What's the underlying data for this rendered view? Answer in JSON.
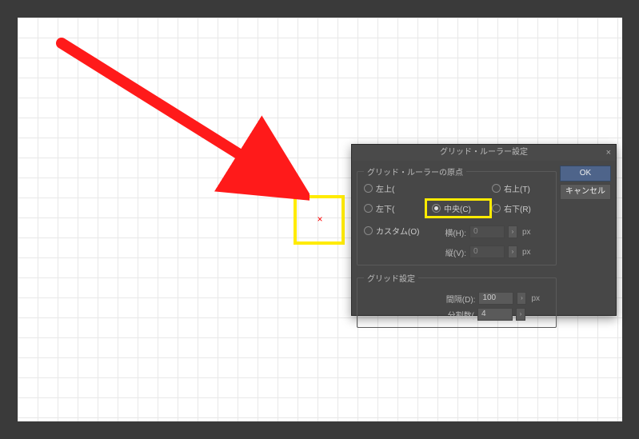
{
  "dialog": {
    "title": "グリッド・ルーラー設定",
    "origin": {
      "legend": "グリッド・ルーラーの原点",
      "top_left": "左上(",
      "center": "中央(C)",
      "top_right": "右上(T)",
      "bottom_left": "左下(",
      "bottom_right": "右下(R)",
      "custom": "カスタム(O)",
      "h_label": "横(H):",
      "h_value": "0",
      "v_label": "縦(V):",
      "v_value": "0",
      "unit": "px"
    },
    "grid": {
      "legend": "グリッド設定",
      "spacing_label": "間隔(D):",
      "spacing_value": "100",
      "spacing_unit": "px",
      "division_label": "分割数(",
      "division_value": "4"
    },
    "ok": "OK",
    "cancel": "キャンセル"
  },
  "center_marker": "×"
}
